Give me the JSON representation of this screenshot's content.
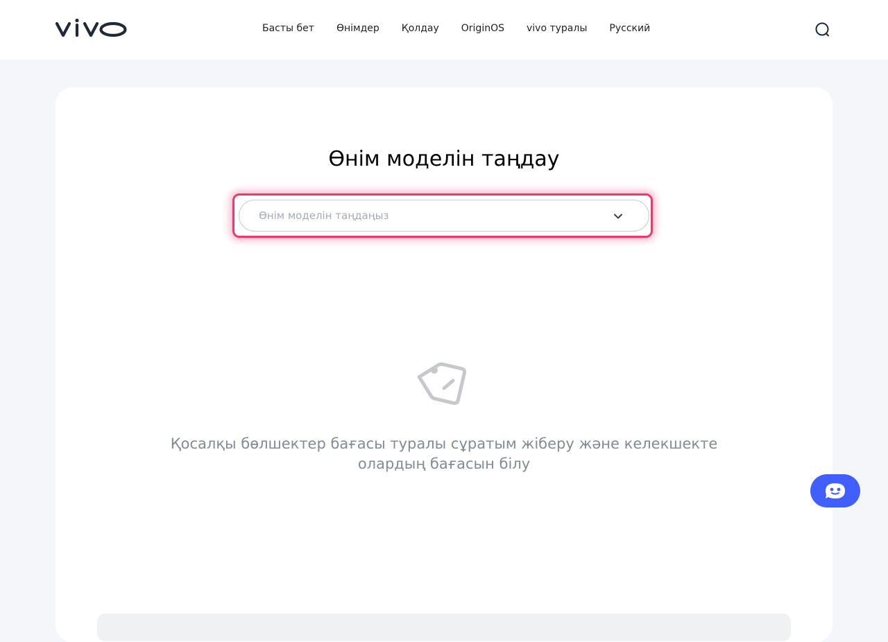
{
  "header": {
    "logo_text": "vivo",
    "nav": [
      {
        "label": "Басты бет"
      },
      {
        "label": "Өнімдер"
      },
      {
        "label": "Қолдау"
      },
      {
        "label": "OriginOS"
      },
      {
        "label": "vivo туралы"
      },
      {
        "label": "Русский"
      }
    ],
    "search_icon": "search-icon"
  },
  "main": {
    "title": "Өнім моделін таңдау",
    "select": {
      "placeholder": "Өнім моделін таңдаңыз",
      "icon": "chevron-down-icon"
    },
    "empty_state": {
      "icon": "tag-icon",
      "text": "Қосалқы бөлшектер бағасы туралы сұратым жіберу және келекшекте олардың бағасын білу"
    }
  },
  "chat": {
    "icon": "chat-bot-icon"
  },
  "colors": {
    "page_bg": "#f5f6f9",
    "accent_highlight": "#ec3a6d",
    "chat_button": "#415fff",
    "muted_text": "#858a93",
    "placeholder_text": "#a7abb3"
  }
}
